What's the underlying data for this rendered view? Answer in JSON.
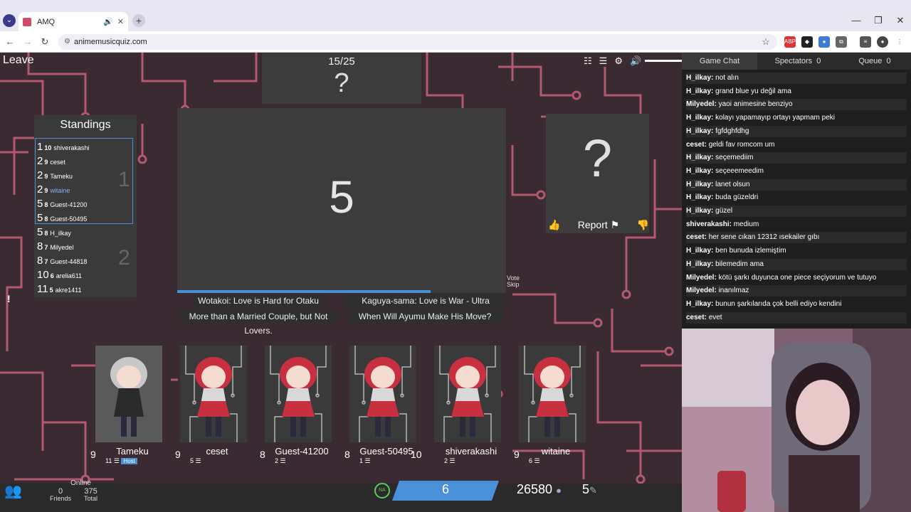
{
  "browser": {
    "tab_title": "AMQ",
    "url": "animemusicquiz.com"
  },
  "game": {
    "leave_label": "Leave",
    "song_counter": "15/25",
    "mystery": "?",
    "timer": "5",
    "vote_skip_line1": "Vote",
    "vote_skip_line2": "Skip",
    "report_label": "Report",
    "answers": [
      "Wotakoi: Love is Hard for Otaku",
      "Kaguya-sama: Love is War - Ultra Romantic",
      "More than a Married Couple, but Not Lovers.",
      "When Will Ayumu Make His Move?"
    ]
  },
  "standings": {
    "title": "Standings",
    "group1_label": "1",
    "group2_label": "2",
    "rows": [
      {
        "pos": "1",
        "score": "10",
        "name": "shiverakashi",
        "highlight": false
      },
      {
        "pos": "2",
        "score": "9",
        "name": "ceset",
        "highlight": false
      },
      {
        "pos": "2",
        "score": "9",
        "name": "Tameku",
        "highlight": false
      },
      {
        "pos": "2",
        "score": "9",
        "name": "witaine",
        "highlight": true
      },
      {
        "pos": "5",
        "score": "8",
        "name": "Guest-41200",
        "highlight": false
      },
      {
        "pos": "5",
        "score": "8",
        "name": "Guest-50495",
        "highlight": false
      },
      {
        "pos": "5",
        "score": "8",
        "name": "H_ilkay",
        "highlight": false
      },
      {
        "pos": "8",
        "score": "7",
        "name": "Milyedel",
        "highlight": false
      },
      {
        "pos": "8",
        "score": "7",
        "name": "Guest-44818",
        "highlight": false
      },
      {
        "pos": "10",
        "score": "6",
        "name": "arelia611",
        "highlight": false
      },
      {
        "pos": "11",
        "score": "5",
        "name": "akre1411",
        "highlight": false
      }
    ]
  },
  "players": [
    {
      "name": "Tameku",
      "score": "9",
      "sub": "11",
      "host": "Host"
    },
    {
      "name": "ceset",
      "score": "9",
      "sub": "5",
      "host": ""
    },
    {
      "name": "Guest-41200",
      "score": "8",
      "sub": "2",
      "host": ""
    },
    {
      "name": "Guest-50495",
      "score": "8",
      "sub": "1",
      "host": ""
    },
    {
      "name": "shiverakashi",
      "score": "10",
      "sub": "2",
      "host": ""
    },
    {
      "name": "witaine",
      "score": "9",
      "sub": "6",
      "host": ""
    }
  ],
  "footer": {
    "online_label": "Online",
    "friends_count": "0",
    "friends_label": "Friends",
    "total_count": "375",
    "total_label": "Total",
    "region": "NA",
    "level": "6",
    "notes": "26580",
    "tickets": "5"
  },
  "chat": {
    "tabs": [
      {
        "label": "Game Chat",
        "count": ""
      },
      {
        "label": "Spectators",
        "count": "0"
      },
      {
        "label": "Queue",
        "count": "0"
      }
    ],
    "messages": [
      {
        "user": "H_ilkay:",
        "text": "not alın"
      },
      {
        "user": "H_ilkay:",
        "text": "grand blue yu değil ama"
      },
      {
        "user": "Milyedel:",
        "text": "yaoi animesine benziyo"
      },
      {
        "user": "H_ilkay:",
        "text": "kolayı yapamayıp ortayı yapmam peki"
      },
      {
        "user": "H_ilkay:",
        "text": "fgfdghfdhg"
      },
      {
        "user": "ceset:",
        "text": "geldi fav romcom um"
      },
      {
        "user": "H_ilkay:",
        "text": "seçemediim"
      },
      {
        "user": "H_ilkay:",
        "text": "seçeeemeedim"
      },
      {
        "user": "H_ilkay:",
        "text": "lanet olsun"
      },
      {
        "user": "H_ilkay:",
        "text": "buda güzeldri"
      },
      {
        "user": "H_ilkay:",
        "text": "güzel"
      },
      {
        "user": "shiverakashi:",
        "text": "medium"
      },
      {
        "user": "ceset:",
        "text": "her sene cıkan 12312 ısekailer gıbı"
      },
      {
        "user": "H_ilkay:",
        "text": "ben bunuda izlemiştim"
      },
      {
        "user": "H_ilkay:",
        "text": "bilemedim ama"
      },
      {
        "user": "Milyedel:",
        "text": "kötü şarkı duyunca one piece seçiyorum ve tutuyo"
      },
      {
        "user": "Milyedel:",
        "text": "inanılmaz"
      },
      {
        "user": "H_ilkay:",
        "text": "bunun şarkılarıda çok belli ediyo kendini"
      },
      {
        "user": "ceset:",
        "text": "evet"
      }
    ]
  },
  "colors": {
    "accent_blue": "#4a90d9",
    "circuit_pink": "#c8607a",
    "na_green": "#5bc95b"
  }
}
